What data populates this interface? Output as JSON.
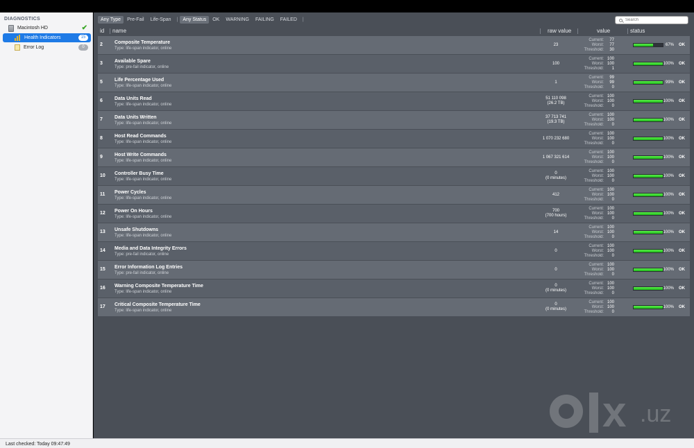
{
  "sidebar": {
    "header": "DIAGNOSTICS",
    "disk_label": "Macintosh HD",
    "health_label": "Health Indicators",
    "health_badge": "15",
    "errorlog_label": "Error Log",
    "errorlog_badge": "0"
  },
  "toolbar": {
    "type_filters": [
      "Any Type",
      "Pre-Fail",
      "Life-Span"
    ],
    "status_filters": [
      "Any Status",
      "OK",
      "WARNING",
      "FAILING",
      "FAILED"
    ],
    "search_placeholder": "Search"
  },
  "table": {
    "headers": {
      "id": "id",
      "name": "name",
      "raw": "raw value",
      "value": "value",
      "status": "status"
    },
    "labels": {
      "current": "Current:",
      "worst": "Worst:",
      "threshold": "Threshold:"
    },
    "rows": [
      {
        "id": "2",
        "name": "Composite Temperature",
        "type": "Type: life-span indicator, online",
        "raw": "23",
        "raw2": "",
        "current": "77",
        "worst": "77",
        "threshold": "30",
        "percent": 67,
        "pct_label": "67%",
        "status": "OK"
      },
      {
        "id": "3",
        "name": "Available Spare",
        "type": "Type: pre-fail indicator, online",
        "raw": "100",
        "raw2": "",
        "current": "100",
        "worst": "100",
        "threshold": "1",
        "percent": 100,
        "pct_label": "100%",
        "status": "OK"
      },
      {
        "id": "5",
        "name": "Life Percentage Used",
        "type": "Type: life-span indicator, online",
        "raw": "1",
        "raw2": "",
        "current": "99",
        "worst": "99",
        "threshold": "0",
        "percent": 99,
        "pct_label": "99%",
        "status": "OK"
      },
      {
        "id": "6",
        "name": "Data Units Read",
        "type": "Type: life-span indicator, online",
        "raw": "51 110 098",
        "raw2": "(26.2 TB)",
        "current": "100",
        "worst": "100",
        "threshold": "0",
        "percent": 100,
        "pct_label": "100%",
        "status": "OK"
      },
      {
        "id": "7",
        "name": "Data Units Written",
        "type": "Type: life-span indicator, online",
        "raw": "37 713 741",
        "raw2": "(19.3 TB)",
        "current": "100",
        "worst": "100",
        "threshold": "0",
        "percent": 100,
        "pct_label": "100%",
        "status": "OK"
      },
      {
        "id": "8",
        "name": "Host Read Commands",
        "type": "Type: life-span indicator, online",
        "raw": "1 070 232 680",
        "raw2": "",
        "current": "100",
        "worst": "100",
        "threshold": "0",
        "percent": 100,
        "pct_label": "100%",
        "status": "OK"
      },
      {
        "id": "9",
        "name": "Host Write Commands",
        "type": "Type: life-span indicator, online",
        "raw": "1 067 321 614",
        "raw2": "",
        "current": "100",
        "worst": "100",
        "threshold": "0",
        "percent": 100,
        "pct_label": "100%",
        "status": "OK"
      },
      {
        "id": "10",
        "name": "Controller Busy Time",
        "type": "Type: life-span indicator, online",
        "raw": "0",
        "raw2": "(0 minutes)",
        "current": "100",
        "worst": "100",
        "threshold": "0",
        "percent": 100,
        "pct_label": "100%",
        "status": "OK"
      },
      {
        "id": "11",
        "name": "Power Cycles",
        "type": "Type: life-span indicator, online",
        "raw": "412",
        "raw2": "",
        "current": "100",
        "worst": "100",
        "threshold": "0",
        "percent": 100,
        "pct_label": "100%",
        "status": "OK"
      },
      {
        "id": "12",
        "name": "Power On Hours",
        "type": "Type: life-span indicator, online",
        "raw": "700",
        "raw2": "(700 hours)",
        "current": "100",
        "worst": "100",
        "threshold": "0",
        "percent": 100,
        "pct_label": "100%",
        "status": "OK"
      },
      {
        "id": "13",
        "name": "Unsafe Shutdowns",
        "type": "Type: life-span indicator, online",
        "raw": "14",
        "raw2": "",
        "current": "100",
        "worst": "100",
        "threshold": "0",
        "percent": 100,
        "pct_label": "100%",
        "status": "OK"
      },
      {
        "id": "14",
        "name": "Media and Data Integrity Errors",
        "type": "Type: pre-fail indicator, online",
        "raw": "0",
        "raw2": "",
        "current": "100",
        "worst": "100",
        "threshold": "0",
        "percent": 100,
        "pct_label": "100%",
        "status": "OK"
      },
      {
        "id": "15",
        "name": "Error Information Log Entries",
        "type": "Type: pre-fail indicator, online",
        "raw": "0",
        "raw2": "",
        "current": "100",
        "worst": "100",
        "threshold": "0",
        "percent": 100,
        "pct_label": "100%",
        "status": "OK"
      },
      {
        "id": "16",
        "name": "Warning Composite Temperature Time",
        "type": "Type: life-span indicator, online",
        "raw": "0",
        "raw2": "(0 minutes)",
        "current": "100",
        "worst": "100",
        "threshold": "0",
        "percent": 100,
        "pct_label": "100%",
        "status": "OK"
      },
      {
        "id": "17",
        "name": "Critical Composite Temperature Time",
        "type": "Type: life-span indicator, online",
        "raw": "0",
        "raw2": "(0 minutes)",
        "current": "100",
        "worst": "100",
        "threshold": "0",
        "percent": 100,
        "pct_label": "100%",
        "status": "OK"
      }
    ]
  },
  "statusbar": {
    "text": "Last checked: Today 09:47:49"
  },
  "watermark": {
    "brand": "x",
    "suffix": ".uz"
  },
  "colors": {
    "accent": "#1e7ae6",
    "ok_green": "#2ed62a",
    "panel": "#4a4f57"
  }
}
